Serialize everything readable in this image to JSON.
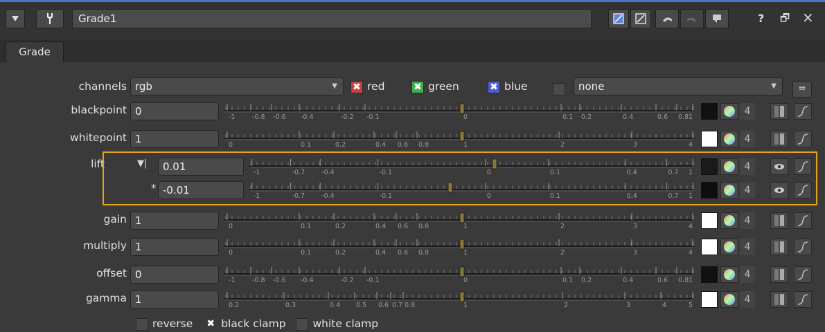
{
  "window": {
    "node_name": "Grade1"
  },
  "toolbar": {
    "help": "?",
    "float": "🗗",
    "close": "×"
  },
  "tabs": [
    {
      "label": "Grade"
    }
  ],
  "channels": {
    "label": "channels",
    "value": "rgb",
    "red": "red",
    "green": "green",
    "blue": "blue",
    "alpha_value": "none",
    "eq_button": "="
  },
  "params": [
    {
      "label": "blackpoint",
      "value": "0",
      "scale": "A",
      "marker": 0,
      "swatch": "#111111"
    },
    {
      "label": "whitepoint",
      "value": "1",
      "scale": "B",
      "marker": 1,
      "swatch": "#ffffff"
    },
    {
      "label": "lift",
      "value": "0.01",
      "scale": "C",
      "marker": 0.01,
      "swatch": "#1a1a1a"
    },
    {
      "label": "",
      "value": "-0.01",
      "scale": "C",
      "marker": -0.01,
      "swatch": "#0e0e0e"
    },
    {
      "label": "gain",
      "value": "1",
      "scale": "B",
      "marker": 1,
      "swatch": "#ffffff"
    },
    {
      "label": "multiply",
      "value": "1",
      "scale": "B",
      "marker": 1,
      "swatch": "#ffffff"
    },
    {
      "label": "offset",
      "value": "0",
      "scale": "A",
      "marker": 0,
      "swatch": "#111111"
    },
    {
      "label": "gamma",
      "value": "1",
      "scale": "D",
      "marker": 1,
      "swatch": "#ffffff"
    }
  ],
  "scales": {
    "A": [
      "-1",
      "-0.8",
      "-0.6",
      "-0.4",
      "-0.2",
      "-0.1",
      "0",
      "0.1",
      "0.2",
      "0.4",
      "0.6",
      "0.8",
      "1"
    ],
    "B": [
      "0",
      "0.1",
      "0.2",
      "0.4",
      "0.6",
      "0.8",
      "1",
      "2",
      "3",
      "4"
    ],
    "C": [
      "-1",
      "-0.7",
      "-0.4",
      "-0.1",
      "0",
      "0.1",
      "0.4",
      "0.7",
      "1"
    ],
    "D": [
      "0.2",
      "0.3",
      "0.4",
      "0.5",
      "0.6",
      "0.7",
      "0.8",
      "1",
      "2",
      "3",
      "4",
      "5"
    ]
  },
  "lift_extra": {
    "split_mark": "▼|",
    "asterisk": "*"
  },
  "channel_count": "4",
  "options": {
    "reverse": "reverse",
    "black_clamp": "black clamp",
    "white_clamp": "white clamp"
  }
}
